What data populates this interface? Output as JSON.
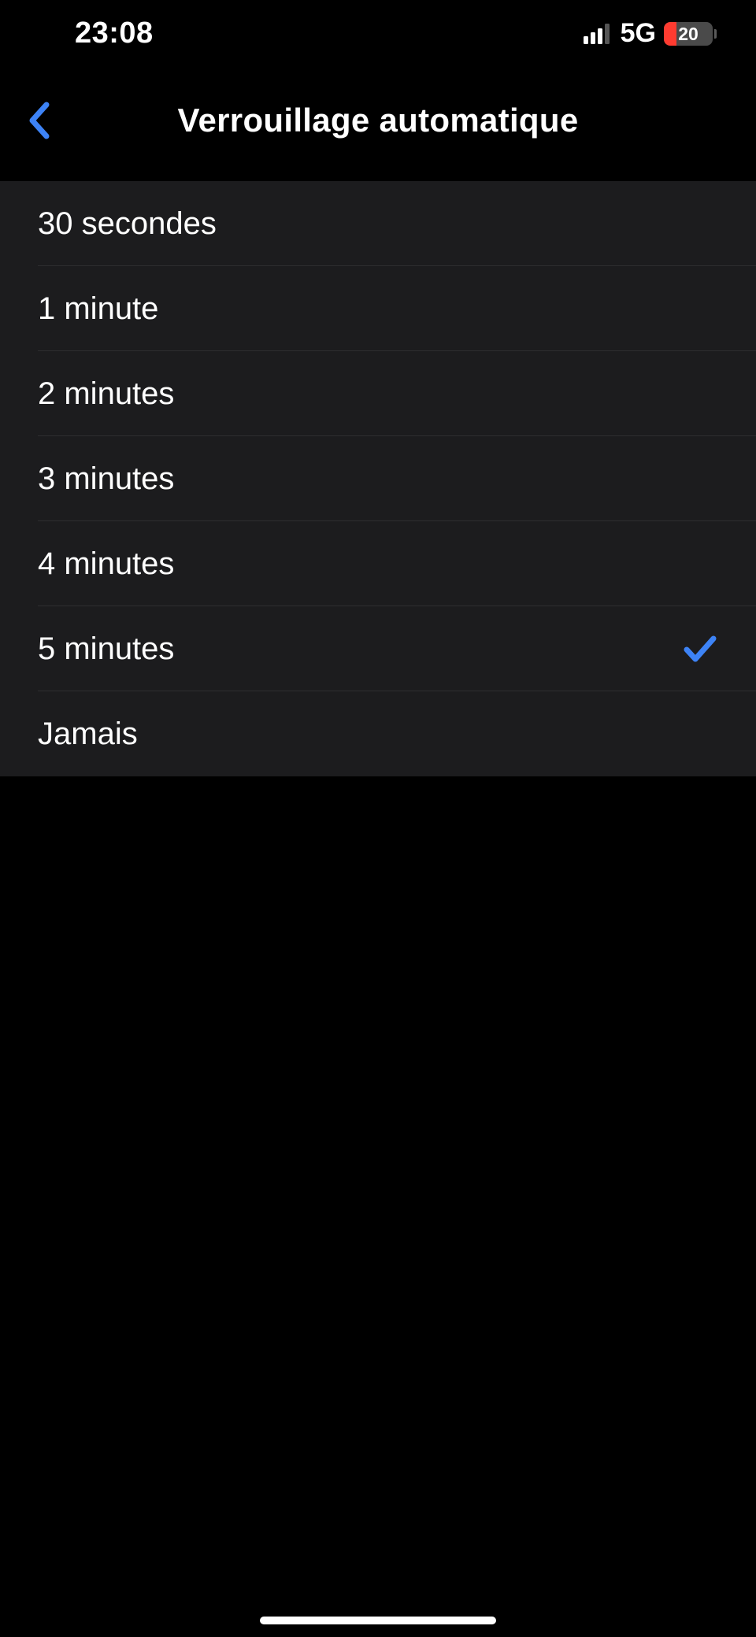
{
  "status": {
    "time": "23:08",
    "network": "5G",
    "battery": "20"
  },
  "nav": {
    "title": "Verrouillage automatique"
  },
  "options": [
    {
      "label": "30 secondes",
      "selected": false
    },
    {
      "label": "1 minute",
      "selected": false
    },
    {
      "label": "2 minutes",
      "selected": false
    },
    {
      "label": "3 minutes",
      "selected": false
    },
    {
      "label": "4 minutes",
      "selected": false
    },
    {
      "label": "5 minutes",
      "selected": true
    },
    {
      "label": "Jamais",
      "selected": false
    }
  ],
  "colors": {
    "accent": "#3d83f6",
    "lowBattery": "#ff3b30",
    "listBg": "#1c1c1e"
  }
}
